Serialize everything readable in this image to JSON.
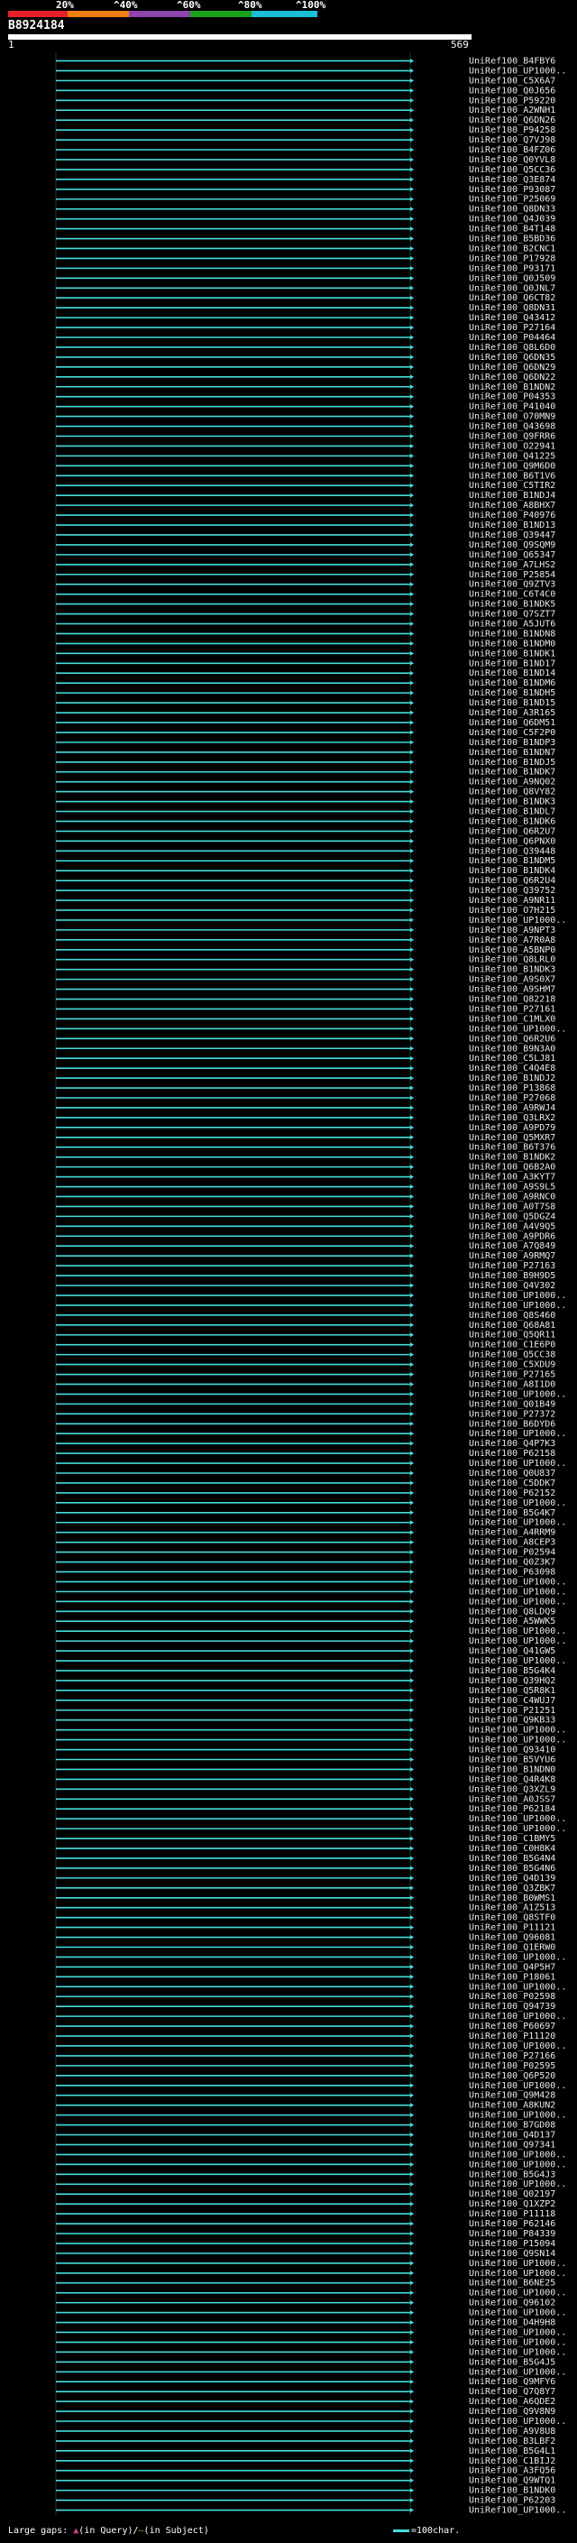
{
  "header": {
    "percent_labels": [
      "20%",
      "^40%",
      "^60%",
      "^80%",
      "^100%"
    ],
    "color_segments": [
      "#e8202a",
      "#f07f12",
      "#8e44ad",
      "#1aa31a",
      "#17c0d8"
    ],
    "query_id": "B8924184",
    "ruler_start": "1",
    "ruler_end": "569"
  },
  "colors": {
    "hit_line": "#4dd",
    "gap_query": "#cc4488",
    "gap_subject": "#6c3"
  },
  "hits": [
    "UniRef100_B4FBY6",
    "UniRef100_UP1000..",
    "UniRef100_C5X6A7",
    "UniRef100_Q0J656",
    "UniRef100_P59220",
    "UniRef100_A2WNH1",
    "UniRef100_Q6DN26",
    "UniRef100_P94258",
    "UniRef100_Q7VJ98",
    "UniRef100_B4FZ06",
    "UniRef100_Q0YVL8",
    "UniRef100_Q5CC36",
    "UniRef100_Q3E874",
    "UniRef100_P93087",
    "UniRef100_P25069",
    "UniRef100_Q8DN33",
    "UniRef100_Q4J039",
    "UniRef100_B4T148",
    "UniRef100_B5BD36",
    "UniRef100_B2CNC1",
    "UniRef100_P17928",
    "UniRef100_P93171",
    "UniRef100_Q0J509",
    "UniRef100_Q0JNL7",
    "UniRef100_Q6CT82",
    "UniRef100_Q8DN31",
    "UniRef100_Q43412",
    "UniRef100_P27164",
    "UniRef100_P04464",
    "UniRef100_Q8L6D0",
    "UniRef100_Q6DN35",
    "UniRef100_Q6DN29",
    "UniRef100_Q6DN22",
    "UniRef100_B1NDN2",
    "UniRef100_P04353",
    "UniRef100_P41040",
    "UniRef100_O70MN9",
    "UniRef100_Q43698",
    "UniRef100_Q9FRR6",
    "UniRef100_O22941",
    "UniRef100_Q41225",
    "UniRef100_Q9M6D0",
    "UniRef100_B6T1V6",
    "UniRef100_C5TIR2",
    "UniRef100_B1NDJ4",
    "UniRef100_A8BHX7",
    "UniRef100_P40976",
    "UniRef100_B1ND13",
    "UniRef100_Q39447",
    "UniRef100_Q9SQM9",
    "UniRef100_Q65347",
    "UniRef100_A7LHS2",
    "UniRef100_P25854",
    "UniRef100_Q9ZTV3",
    "UniRef100_C6T4C0",
    "UniRef100_B1NDK5",
    "UniRef100_Q7SZT7",
    "UniRef100_A5JUT6",
    "UniRef100_B1NDN8",
    "UniRef100_B1NDM0",
    "UniRef100_B1NDK1",
    "UniRef100_B1ND17",
    "UniRef100_B1ND14",
    "UniRef100_B1NDM6",
    "UniRef100_B1NDH5",
    "UniRef100_B1ND15",
    "UniRef100_A3R165",
    "UniRef100_Q6DM51",
    "UniRef100_C5F2P0",
    "UniRef100_B1NDP3",
    "UniRef100_B1NDN7",
    "UniRef100_B1NDJ5",
    "UniRef100_B1NDK7",
    "UniRef100_A9NQ02",
    "UniRef100_Q8VY82",
    "UniRef100_B1NDK3",
    "UniRef100_B1NDL7",
    "UniRef100_B1NDK6",
    "UniRef100_Q6R2U7",
    "UniRef100_Q6PNX0",
    "UniRef100_Q39448",
    "UniRef100_B1NDM5",
    "UniRef100_B1NDK4",
    "UniRef100_Q6R2U4",
    "UniRef100_Q39752",
    "UniRef100_A9NR11",
    "UniRef100_O7H215",
    "UniRef100_UP1000..",
    "UniRef100_A9NPT3",
    "UniRef100_A7R0A8",
    "UniRef100_A5BNP0",
    "UniRef100_Q8LRL0",
    "UniRef100_B1NDK3",
    "UniRef100_A9S0X7",
    "UniRef100_A9SHM7",
    "UniRef100_Q82218",
    "UniRef100_P27161",
    "UniRef100_C1MLX0",
    "UniRef100_UP1000..",
    "UniRef100_Q6R2U6",
    "UniRef100_B9N3A0",
    "UniRef100_C5LJ81",
    "UniRef100_C4Q4E8",
    "UniRef100_B1NDJ2",
    "UniRef100_P13868",
    "UniRef100_P27068",
    "UniRef100_A9RWJ4",
    "UniRef100_Q3LRX2",
    "UniRef100_A9PD79",
    "UniRef100_Q5MXR7",
    "UniRef100_B6T376",
    "UniRef100_B1NDK2",
    "UniRef100_Q6B2A0",
    "UniRef100_A3KYT7",
    "UniRef100_A9S9L5",
    "UniRef100_A9RNC0",
    "UniRef100_A0T7S8",
    "UniRef100_Q5DGZ4",
    "UniRef100_A4V9Q5",
    "UniRef100_A9PDR6",
    "UniRef100_A7Q849",
    "UniRef100_A9RMQ7",
    "UniRef100_P27163",
    "UniRef100_B9H9D5",
    "UniRef100_Q4V302",
    "UniRef100_UP1000..",
    "UniRef100_UP1000..",
    "UniRef100_Q8S460",
    "UniRef100_Q68A81",
    "UniRef100_Q5QR11",
    "UniRef100_C1E6P0",
    "UniRef100_Q5CC38",
    "UniRef100_C5XDU9",
    "UniRef100_P27165",
    "UniRef100_A8I1D0",
    "UniRef100_UP1000..",
    "UniRef100_Q01B49",
    "UniRef100_P27372",
    "UniRef100_B6DYD6",
    "UniRef100_UP1000..",
    "UniRef100_Q4P7K3",
    "UniRef100_P62158",
    "UniRef100_UP1000..",
    "UniRef100_Q0U837",
    "UniRef100_C5DDK7",
    "UniRef100_P62152",
    "UniRef100_UP1000..",
    "UniRef100_B5G4K7",
    "UniRef100_UP1000..",
    "UniRef100_A4RRM9",
    "UniRef100_A8CEP3",
    "UniRef100_P02594",
    "UniRef100_Q0Z3K7",
    "UniRef100_P63098",
    "UniRef100_UP1000..",
    "UniRef100_UP1000..",
    "UniRef100_UP1000..",
    "UniRef100_Q8LDQ9",
    "UniRef100_A5WWK5",
    "UniRef100_UP1000..",
    "UniRef100_UP1000..",
    "UniRef100_Q41GW5",
    "UniRef100_UP1000..",
    "UniRef100_B5G4K4",
    "UniRef100_Q39HQ2",
    "UniRef100_Q5R8K1",
    "UniRef100_C4WUJ7",
    "UniRef100_P21251",
    "UniRef100_Q9KB33",
    "UniRef100_UP1000..",
    "UniRef100_UP1000..",
    "UniRef100_Q93410",
    "UniRef100_B5VYU6",
    "UniRef100_B1NDN0",
    "UniRef100_Q4R4K8",
    "UniRef100_Q3XZL9",
    "UniRef100_A0JSS7",
    "UniRef100_P62184",
    "UniRef100_UP1000..",
    "UniRef100_UP1000..",
    "UniRef100_C1BMY5",
    "UniRef100_C0H8K4",
    "UniRef100_B5G4N4",
    "UniRef100_B5G4N6",
    "UniRef100_Q4D139",
    "UniRef100_Q3ZBK7",
    "UniRef100_B0WMS1",
    "UniRef100_A1Z513",
    "UniRef100_Q8STF0",
    "UniRef100_P11121",
    "UniRef100_Q96081",
    "UniRef100_Q1ERW0",
    "UniRef100_UP1000..",
    "UniRef100_Q4P5H7",
    "UniRef100_P18061",
    "UniRef100_UP1000..",
    "UniRef100_P02598",
    "UniRef100_Q94739",
    "UniRef100_UP1000..",
    "UniRef100_P60697",
    "UniRef100_P11120",
    "UniRef100_UP1000..",
    "UniRef100_P27166",
    "UniRef100_P02595",
    "UniRef100_Q6P520",
    "UniRef100_UP1000..",
    "UniRef100_Q9M428",
    "UniRef100_A8KUN2",
    "UniRef100_UP1000..",
    "UniRef100_B7GD08",
    "UniRef100_Q4D137",
    "UniRef100_Q97341",
    "UniRef100_UP1000..",
    "UniRef100_UP1000..",
    "UniRef100_B5G4J3",
    "UniRef100_UP1000..",
    "UniRef100_Q02197",
    "UniRef100_Q1XZP2",
    "UniRef100_P11118",
    "UniRef100_P62146",
    "UniRef100_P84339",
    "UniRef100_P15094",
    "UniRef100_Q9SN14",
    "UniRef100_UP1000..",
    "UniRef100_UP1000..",
    "UniRef100_B6NE25",
    "UniRef100_UP1000..",
    "UniRef100_Q96102",
    "UniRef100_UP1000..",
    "UniRef100_D4H9H8",
    "UniRef100_UP1000..",
    "UniRef100_UP1000..",
    "UniRef100_UP1000..",
    "UniRef100_B5G4J5",
    "UniRef100_UP1000..",
    "UniRef100_Q9MFY6",
    "UniRef100_Q7Q8Y7",
    "UniRef100_A6QDE2",
    "UniRef100_Q9V8N9",
    "UniRef100_UP1000..",
    "UniRef100_A9V8U8",
    "UniRef100_B3LBF2",
    "UniRef100_B5G4L1",
    "UniRef100_C1BIJ2",
    "UniRef100_A3FQ56",
    "UniRef100_Q9WTQ1",
    "UniRef100_B1NDK0",
    "UniRef100_P62203",
    "UniRef100_UP1000.."
  ],
  "footer": {
    "large_gaps": "Large gaps: ",
    "query_part": "(in Query)/",
    "subject_part": "(in Subject)",
    "legend_text": "=100char."
  }
}
